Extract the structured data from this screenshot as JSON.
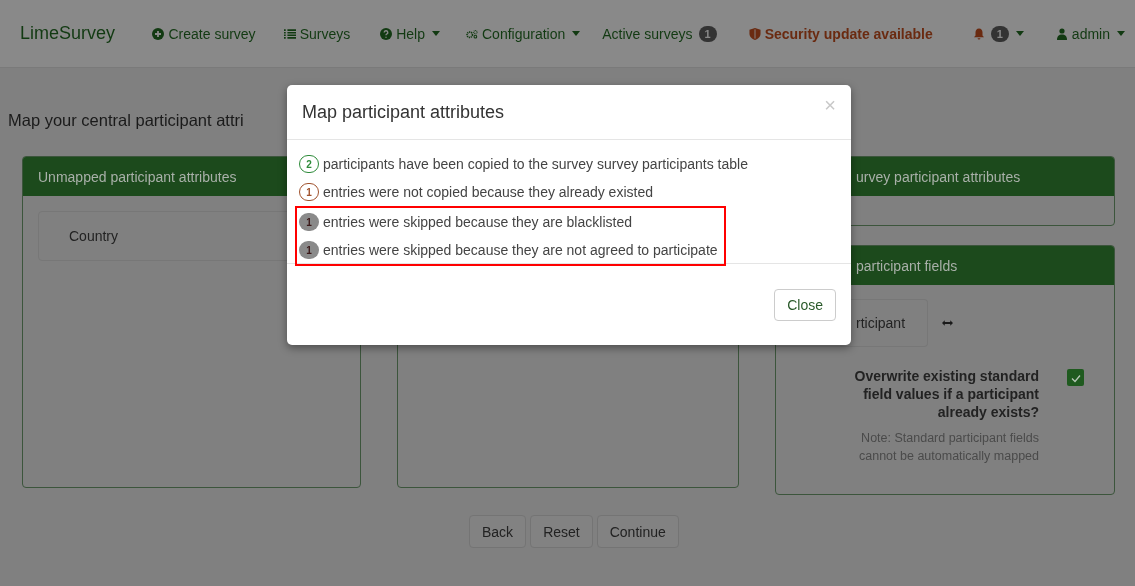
{
  "navbar": {
    "brand": "LimeSurvey",
    "items": [
      {
        "kind": "create",
        "label": "Create survey"
      },
      {
        "kind": "list",
        "label": "Surveys"
      },
      {
        "kind": "help",
        "label": "Help",
        "caret": true
      },
      {
        "kind": "config",
        "label": "Configuration",
        "caret": true
      },
      {
        "kind": "plain",
        "label": "Active surveys",
        "badge": "1"
      },
      {
        "kind": "security",
        "label": "Security update available"
      },
      {
        "kind": "bell",
        "badge": "1",
        "caret": true
      },
      {
        "kind": "user",
        "label": "admin",
        "caret": true
      }
    ]
  },
  "page_title": "Map your central participant attri",
  "unmapped_panel": {
    "title": "Unmapped participant attributes",
    "items": [
      "Country"
    ]
  },
  "survey_attributes_panel": {
    "title": "urvey participant attributes"
  },
  "standard_fields_panel": {
    "title": "participant fields",
    "field": "rticipant",
    "overwrite": {
      "label": "Overwrite existing standard field values if a participant already exists?",
      "checked": true
    },
    "note": "Note: Standard participant fields cannot be automatically mapped"
  },
  "buttons": [
    "Back",
    "Reset",
    "Continue"
  ],
  "modal": {
    "title": "Map participant attributes",
    "close_symbol": "×",
    "messages": [
      {
        "count": "2",
        "text": "participants have been copied to the survey survey participants table",
        "kind": "outline",
        "color": "#2e8b3a"
      },
      {
        "count": "1",
        "text": "entries were not copied because they already existed",
        "kind": "outline",
        "color": "#a0522d"
      }
    ],
    "highlighted_messages": [
      {
        "count": "1",
        "text": "entries were skipped because they are blacklisted",
        "kind": "filled",
        "color": "#8a8a8a"
      },
      {
        "count": "1",
        "text": "entries were skipped because they are not agreed to participate",
        "kind": "filled",
        "color": "#8a8a8a"
      }
    ],
    "close_button": "Close"
  }
}
